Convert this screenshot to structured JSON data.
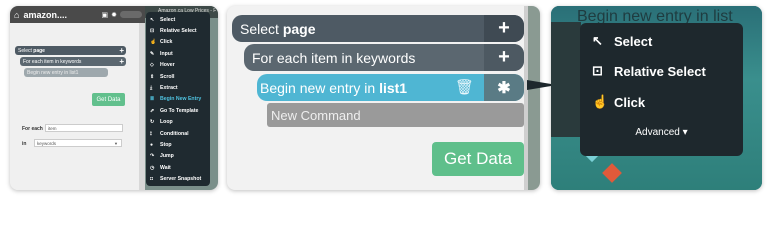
{
  "left": {
    "app_title": "amazon....",
    "page_bar_text": "Amazon.ca Low Prices - F",
    "select_page": {
      "prefix": "Select",
      "bold": "page"
    },
    "for_each": "For each item in keywords",
    "begin_new_entry": "Begin new entry in list1",
    "get_data": "Get Data",
    "for_each_label": "For each",
    "for_each_value": "item",
    "in_label": "in",
    "in_value": "keywords",
    "menu": [
      {
        "icon": "cursor-icon",
        "glyph": "↖",
        "label": "Select",
        "highlight": false
      },
      {
        "icon": "relative-select-icon",
        "glyph": "⊡",
        "label": "Relative Select",
        "highlight": false
      },
      {
        "icon": "click-icon",
        "glyph": "☝",
        "label": "Click",
        "highlight": false
      },
      {
        "icon": "pencil-icon",
        "glyph": "✎",
        "label": "Input",
        "highlight": false
      },
      {
        "icon": "hover-icon",
        "glyph": "◇",
        "label": "Hover",
        "highlight": false
      },
      {
        "icon": "scroll-icon",
        "glyph": "⇕",
        "label": "Scroll",
        "highlight": false
      },
      {
        "icon": "extract-icon",
        "glyph": "⤓",
        "label": "Extract",
        "highlight": false
      },
      {
        "icon": "list-icon",
        "glyph": "≣",
        "label": "Begin New Entry",
        "highlight": true
      },
      {
        "icon": "template-icon",
        "glyph": "⇗",
        "label": "Go To Template",
        "highlight": false
      },
      {
        "icon": "loop-icon",
        "glyph": "↻",
        "label": "Loop",
        "highlight": false
      },
      {
        "icon": "conditional-icon",
        "glyph": "⟟",
        "label": "Conditional",
        "highlight": false
      },
      {
        "icon": "stop-icon",
        "glyph": "●",
        "label": "Stop",
        "highlight": false
      },
      {
        "icon": "jump-icon",
        "glyph": "↷",
        "label": "Jump",
        "highlight": false
      },
      {
        "icon": "wait-icon",
        "glyph": "◷",
        "label": "Wait",
        "highlight": false
      },
      {
        "icon": "snapshot-icon",
        "glyph": "◘",
        "label": "Server Snapshot",
        "highlight": false
      }
    ]
  },
  "middle": {
    "select_page": {
      "prefix": "Select ",
      "bold": "page"
    },
    "for_each": "For each item in keywords",
    "begin_new_entry": {
      "prefix": "Begin new entry in ",
      "bold": "list1"
    },
    "new_command": "New Command",
    "get_data": "Get Data"
  },
  "right": {
    "page_title": "Begin new entry in list",
    "menu": [
      {
        "icon": "cursor-icon",
        "glyph": "↖",
        "label": "Select"
      },
      {
        "icon": "relative-select-icon",
        "glyph": "⊡",
        "label": "Relative Select"
      },
      {
        "icon": "click-icon",
        "glyph": "☝",
        "label": "Click"
      }
    ],
    "advanced": "Advanced ▾"
  },
  "colors": {
    "select_bar": "#4e5a64",
    "foreach_bar": "#5b6770",
    "entry_bar": "#4fb6d3",
    "new_command": "#9a9a9a",
    "get_data": "#5fbf8b",
    "menu_bg": "#1e282d",
    "highlight": "#4fc3e0"
  }
}
